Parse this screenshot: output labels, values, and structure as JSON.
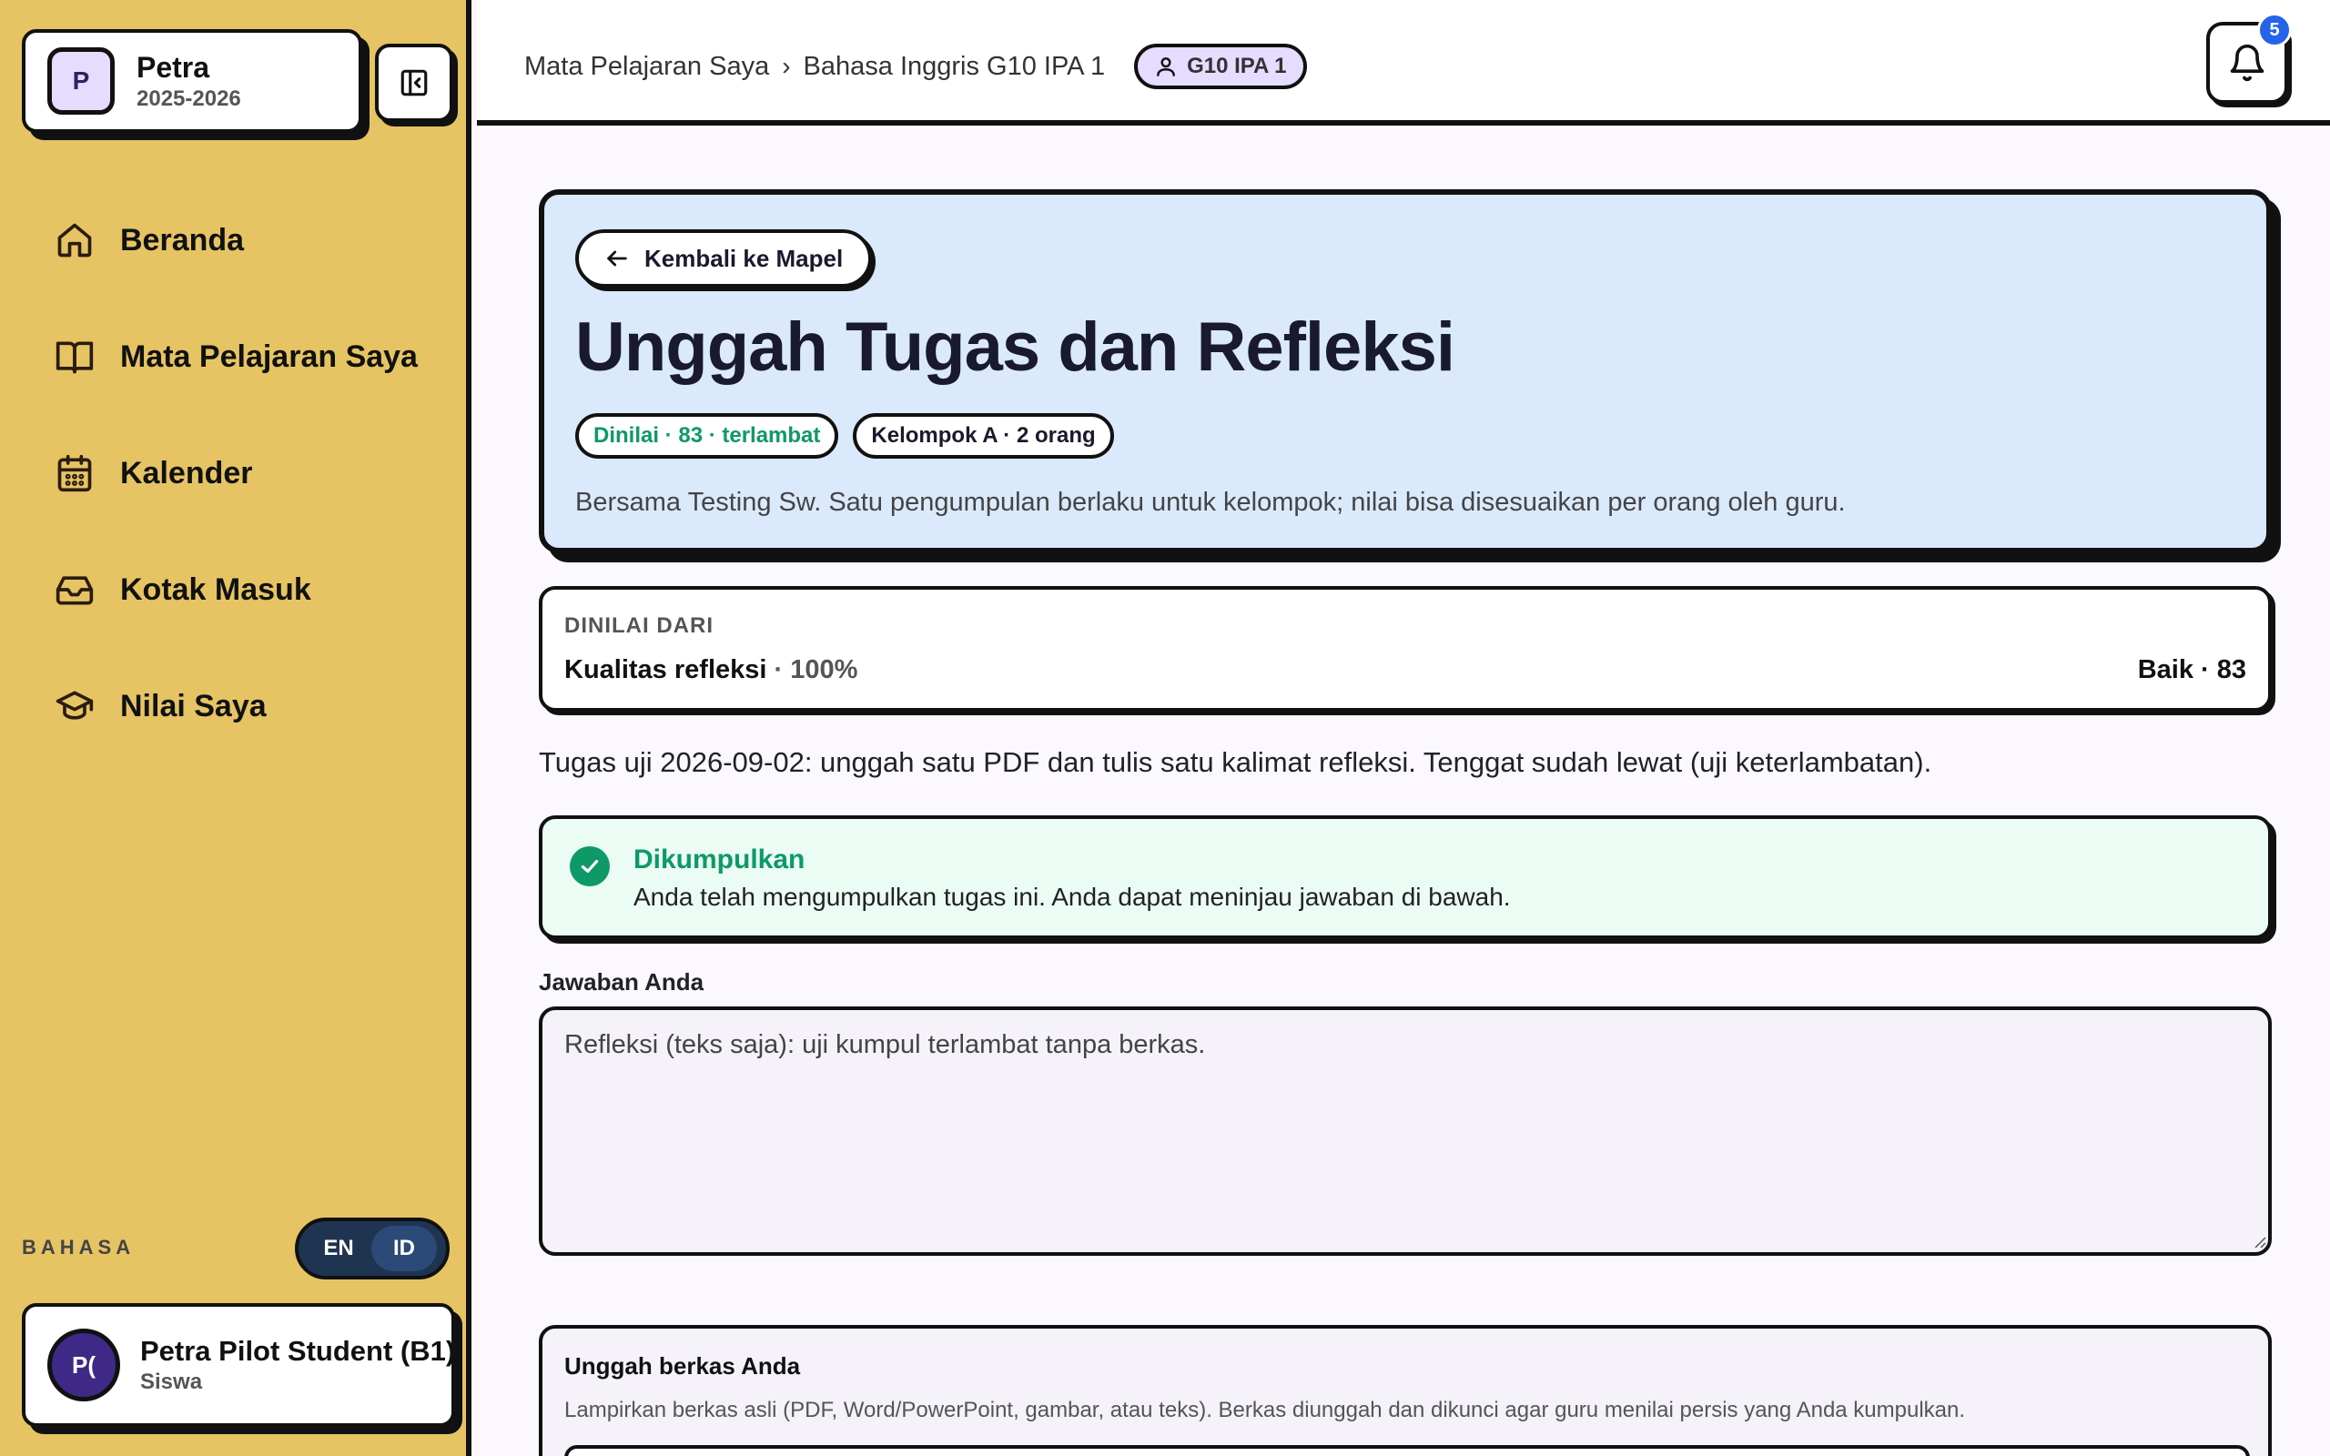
{
  "sidebar": {
    "school": {
      "initial": "P",
      "name": "Petra",
      "year": "2025-2026"
    },
    "nav": [
      {
        "label": "Beranda",
        "icon": "home-icon"
      },
      {
        "label": "Mata Pelajaran Saya",
        "icon": "book-icon"
      },
      {
        "label": "Kalender",
        "icon": "calendar-icon"
      },
      {
        "label": "Kotak Masuk",
        "icon": "inbox-icon"
      },
      {
        "label": "Nilai Saya",
        "icon": "graduation-cap-icon"
      }
    ],
    "language": {
      "label": "BAHASA",
      "options": [
        "EN",
        "ID"
      ],
      "selected": "ID"
    },
    "user": {
      "initials": "P(",
      "name": "Petra Pilot Student (B1)",
      "role": "Siswa"
    }
  },
  "topbar": {
    "breadcrumbs": [
      "Mata Pelajaran Saya",
      "Bahasa Inggris G10 IPA 1"
    ],
    "class_chip": "G10 IPA 1",
    "notification_count": "5"
  },
  "assignment": {
    "back_label": "Kembali ke Mapel",
    "title": "Unggah Tugas dan Refleksi",
    "badges": {
      "status": "Dinilai · 83 · terlambat",
      "group": "Kelompok A · 2 orang"
    },
    "description": "Bersama Testing Sw. Satu pengumpulan berlaku untuk kelompok; nilai bisa disesuaikan per orang oleh guru.",
    "rubric": {
      "heading": "DINILAI DARI",
      "criterion": "Kualitas refleksi",
      "weight": "· 100%",
      "score": "Baik · 83"
    },
    "instructions": "Tugas uji 2026-09-02: unggah satu PDF dan tulis satu kalimat refleksi. Tenggat sudah lewat (uji keterlambatan).",
    "status": {
      "title": "Dikumpulkan",
      "text": "Anda telah mengumpulkan tugas ini. Anda dapat meninjau jawaban di bawah."
    },
    "answer": {
      "label": "Jawaban Anda",
      "value": "Refleksi (teks saja): uji kumpul terlambat tanpa berkas."
    },
    "upload": {
      "title": "Unggah berkas Anda",
      "description": "Lampirkan berkas asli (PDF, Word/PowerPoint, gambar, atau teks). Berkas diunggah dan dikunci agar guru menilai persis yang Anda kumpulkan."
    }
  },
  "colors": {
    "sidebar_bg": "#e6c363",
    "hero_bg": "#dbe9fd",
    "success": "#0d9a68",
    "badge_blue": "#2563eb"
  }
}
